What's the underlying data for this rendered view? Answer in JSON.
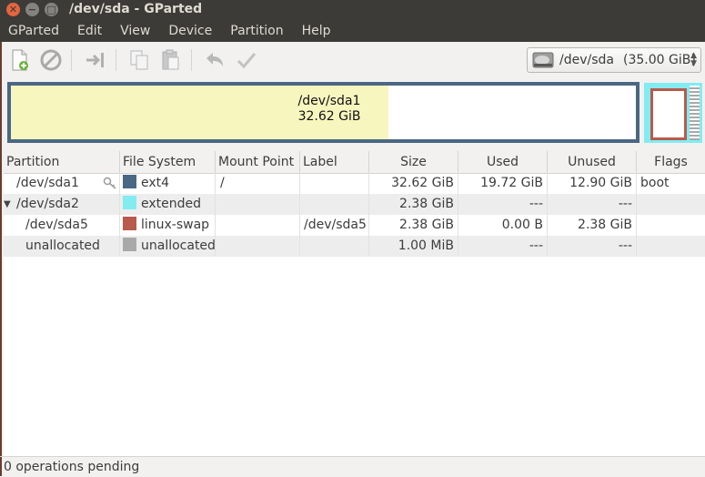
{
  "window": {
    "title": "/dev/sda - GParted"
  },
  "menubar": {
    "items": [
      "GParted",
      "Edit",
      "View",
      "Device",
      "Partition",
      "Help"
    ]
  },
  "toolbar": {
    "buttons": [
      {
        "icon": "new-partition-icon"
      },
      {
        "icon": "delete-icon"
      },
      {
        "icon": "resize-move-icon"
      },
      {
        "icon": "copy-icon"
      },
      {
        "icon": "paste-icon"
      },
      {
        "icon": "undo-icon"
      },
      {
        "icon": "apply-icon"
      }
    ],
    "device": {
      "path": "/dev/sda",
      "size": "(35.00 GiB)"
    }
  },
  "graphic": {
    "sda1_name": "/dev/sda1",
    "sda1_size": "32.62 GiB",
    "colors": {
      "disk_border": "#4a6784",
      "ext4_fill": "#f7f6bf",
      "extended": "#82ecf1",
      "swap": "#b85a4c",
      "unallocated": "#a9a9a9"
    }
  },
  "table": {
    "headers": {
      "partition": "Partition",
      "filesystem": "File System",
      "mountpoint": "Mount Point",
      "label": "Label",
      "size": "Size",
      "used": "Used",
      "unused": "Unused",
      "flags": "Flags"
    },
    "rows": [
      {
        "partition": "/dev/sda1",
        "filesystem": "ext4",
        "fs_color": "#4a6784",
        "mountpoint": "/",
        "label": "",
        "size": "32.62 GiB",
        "used": "19.72 GiB",
        "unused": "12.90 GiB",
        "flags": "boot"
      },
      {
        "partition": "/dev/sda2",
        "filesystem": "extended",
        "fs_color": "#82ecf1",
        "mountpoint": "",
        "label": "",
        "size": "2.38 GiB",
        "used": "---",
        "unused": "---",
        "flags": ""
      },
      {
        "partition": "/dev/sda5",
        "filesystem": "linux-swap",
        "fs_color": "#b85a4c",
        "mountpoint": "",
        "label": "/dev/sda5",
        "size": "2.38 GiB",
        "used": "0.00 B",
        "unused": "2.38 GiB",
        "flags": ""
      },
      {
        "partition": "unallocated",
        "filesystem": "unallocated",
        "fs_color": "#a9a9a9",
        "mountpoint": "",
        "label": "",
        "size": "1.00 MiB",
        "used": "---",
        "unused": "---",
        "flags": ""
      }
    ]
  },
  "statusbar": {
    "text": "0 operations pending"
  }
}
